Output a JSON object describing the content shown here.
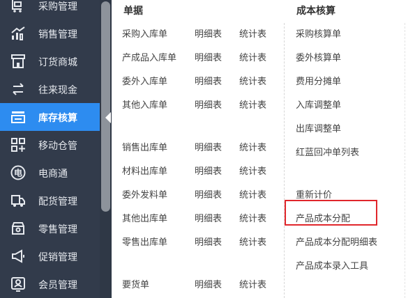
{
  "sidebar": {
    "items": [
      {
        "label": "采购管理",
        "icon": "purchase-cart-icon",
        "active": false
      },
      {
        "label": "销售管理",
        "icon": "sales-chart-icon",
        "active": false
      },
      {
        "label": "订货商城",
        "icon": "store-icon",
        "active": false
      },
      {
        "label": "往来现金",
        "icon": "exchange-arrows-icon",
        "active": false
      },
      {
        "label": "库存核算",
        "icon": "inventory-tray-icon",
        "active": true
      },
      {
        "label": "移动仓管",
        "icon": "apps-grid-icon",
        "active": false
      },
      {
        "label": "电商通",
        "icon": "ecommerce-circle-icon",
        "active": false
      },
      {
        "label": "配货管理",
        "icon": "delivery-truck-icon",
        "active": false
      },
      {
        "label": "零售管理",
        "icon": "retail-shop-icon",
        "active": false
      },
      {
        "label": "促销管理",
        "icon": "megaphone-icon",
        "active": false
      },
      {
        "label": "会员管理",
        "icon": "member-card-icon",
        "active": false
      }
    ],
    "colors": {
      "background": "#323b4b",
      "active": "#2d8cf0"
    }
  },
  "documents": {
    "title": "单据",
    "rows": [
      {
        "name": "采购入库单",
        "detail": "明细表",
        "stats": "统计表"
      },
      {
        "name": "产成品入库单",
        "detail": "明细表",
        "stats": "统计表"
      },
      {
        "name": "委外入库单",
        "detail": "明细表",
        "stats": "统计表"
      },
      {
        "name": "其他入库单",
        "detail": "明细表",
        "stats": "统计表"
      },
      {
        "name": "销售出库单",
        "detail": "明细表",
        "stats": "统计表"
      },
      {
        "name": "材料出库单",
        "detail": "明细表",
        "stats": "统计表"
      },
      {
        "name": "委外发料单",
        "detail": "明细表",
        "stats": "统计表"
      },
      {
        "name": "其他出库单",
        "detail": "明细表",
        "stats": "统计表"
      },
      {
        "name": "零售出库单",
        "detail": "明细表",
        "stats": "统计表"
      },
      {
        "name": "要货单",
        "detail": "明细表",
        "stats": "统计表"
      }
    ]
  },
  "costing": {
    "title": "成本核算",
    "items": [
      "采购核算单",
      "委外核算单",
      "费用分摊单",
      "入库调整单",
      "出库调整单",
      "红蓝回冲单列表",
      "重新计价",
      "产品成本分配",
      "产品成本分配明细表",
      "产品成本录入工具"
    ],
    "highlighted": "产品成本分配",
    "highlight_color": "#e0262b"
  }
}
